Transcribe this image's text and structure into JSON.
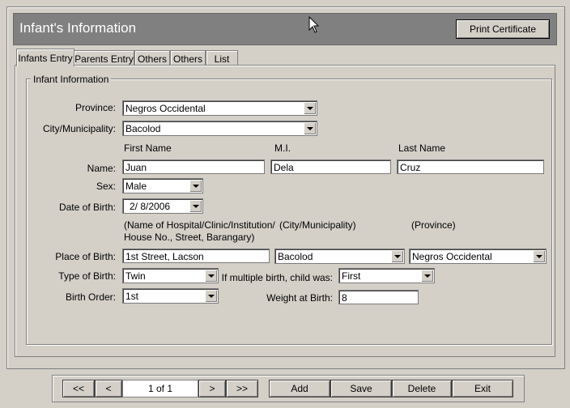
{
  "header": {
    "title": "Infant's Information",
    "print_label": "Print Certificate"
  },
  "tabs": [
    {
      "label": "Infants Entry",
      "active": true
    },
    {
      "label": "Parents Entry"
    },
    {
      "label": "Others"
    },
    {
      "label": "Others"
    },
    {
      "label": "List"
    }
  ],
  "group": {
    "legend": "Infant Information"
  },
  "form": {
    "province_label": "Province:",
    "province_value": "Negros Occidental",
    "city_label": "City/Municipality:",
    "city_value": "Bacolod",
    "first_name_header": "First Name",
    "mi_header": "M.I.",
    "last_name_header": "Last Name",
    "name_label": "Name:",
    "first_name": "Juan",
    "mi": "Dela",
    "last_name": "Cruz",
    "sex_label": "Sex:",
    "sex_value": "Male",
    "dob_label": "Date of Birth:",
    "dob_value": "2/  8/2006",
    "place_hint_1": "(Name of Hospital/Clinic/Institution/",
    "place_hint_2": "House No., Street, Barangary)",
    "place_hint_city": "(City/Municipality)",
    "place_hint_province": "(Province)",
    "place_label": "Place of Birth:",
    "place_value": "1st Street, Lacson",
    "place_city": "Bacolod",
    "place_province": "Negros Occidental",
    "type_label": "Type of Birth:",
    "type_value": "Twin",
    "multiple_label": "If multiple birth, child was:",
    "multiple_value": "First",
    "order_label": "Birth Order:",
    "order_value": "1st",
    "weight_label": "Weight at Birth:",
    "weight_value": "8"
  },
  "nav": {
    "first": "<<",
    "prev": "<",
    "page": "1 of 1",
    "next": ">",
    "last": ">>",
    "add": "Add",
    "save": "Save",
    "delete": "Delete",
    "exit": "Exit"
  }
}
